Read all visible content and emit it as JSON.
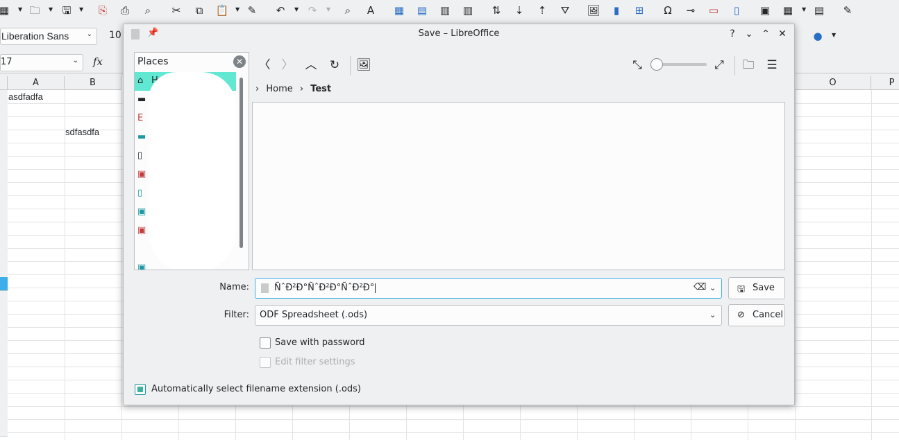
{
  "calc": {
    "toolbar_icons": [
      "table-icon",
      "open-folder-icon",
      "save-icon",
      "export-pdf-icon",
      "print-icon",
      "print-preview-icon",
      "cut-icon",
      "copy-icon",
      "paste-icon",
      "clone-formatting-icon",
      "undo-icon",
      "redo-icon",
      "find-icon",
      "spelling-icon",
      "row-icon",
      "insert-rows-icon",
      "columns-icon",
      "delete-columns-icon",
      "sort-icon",
      "sort-ascending-icon",
      "sort-descending-icon",
      "autofilter-icon",
      "image-icon",
      "chart-icon",
      "pivot-table-icon",
      "special-character-icon",
      "hyperlink-icon",
      "comment-icon",
      "headers-footers-icon",
      "define-print-area-icon",
      "freeze-rows-icon",
      "split-window-icon",
      "draw-functions-icon"
    ],
    "font_name": "Liberation Sans",
    "font_size": "10",
    "name_box": "17",
    "fx_label": "fx",
    "columns": [
      "A",
      "B",
      "O",
      "P"
    ],
    "cells": {
      "a1": "asdfadfa",
      "b4": "sdfasdfa"
    }
  },
  "dialog": {
    "title": "Save – LibreOffice",
    "title_buttons": {
      "help": "?",
      "minimize": "⌄",
      "maximize": "⌃",
      "close": "✕"
    },
    "places": {
      "title": "Places",
      "items": [
        {
          "icon": "home-icon",
          "label": "H"
        },
        {
          "icon": "desktop-icon",
          "label": ""
        },
        {
          "icon": "documents-icon",
          "label": ""
        },
        {
          "icon": "downloads-icon",
          "label": ""
        },
        {
          "icon": "music-icon",
          "label": ""
        },
        {
          "icon": "pictures-icon",
          "label": ""
        },
        {
          "icon": "videos-icon",
          "label": ""
        },
        {
          "icon": "network-icon",
          "label": ""
        },
        {
          "icon": "trash-icon",
          "label": ""
        },
        {
          "icon": "drive-icon",
          "label": ""
        },
        {
          "icon": "drive-icon",
          "label": ""
        }
      ]
    },
    "breadcrumb": {
      "parts": [
        "Home"
      ],
      "current": "Test"
    },
    "name_label": "Name:",
    "name_value": "ÑˆÐ²Ð°ÑˆÐ²Ð°ÑˆÐ²Ð°",
    "filter_label": "Filter:",
    "filter_value": "ODF Spreadsheet (.ods)",
    "save_button": "Save",
    "cancel_button": "Cancel",
    "save_with_password": {
      "label": "Save with password",
      "checked": false
    },
    "edit_filter_settings": {
      "label": "Edit filter settings",
      "checked": false,
      "enabled": false
    },
    "auto_extension": {
      "label": "Automatically select filename extension (.ods)",
      "checked": true
    },
    "accent_color": "#61e8d2",
    "focus_color": "#3daee9"
  }
}
